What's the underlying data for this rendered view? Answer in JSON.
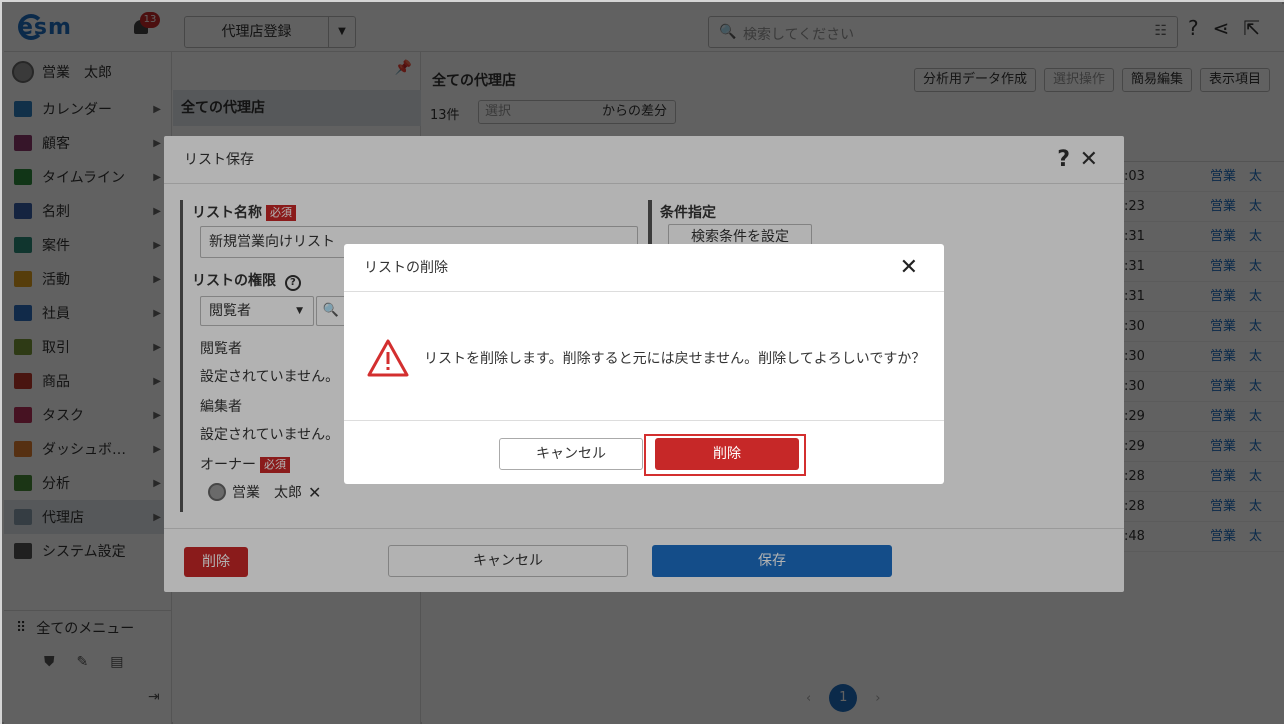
{
  "app": {
    "logo_text": "esm",
    "notifications": "13",
    "register_button": "代理店登録",
    "search_placeholder": "検索してください"
  },
  "user": {
    "name": "営業　太郎"
  },
  "sidebar": {
    "items": [
      {
        "label": "カレンダー",
        "color": "#2e7fbf"
      },
      {
        "label": "顧客",
        "color": "#8e3a6e"
      },
      {
        "label": "タイムライン",
        "color": "#2e8b3e"
      },
      {
        "label": "名刺",
        "color": "#3a5fa8"
      },
      {
        "label": "案件",
        "color": "#2a8a7a"
      },
      {
        "label": "活動",
        "color": "#e0a020"
      },
      {
        "label": "社員",
        "color": "#2e6fbf"
      },
      {
        "label": "取引",
        "color": "#7a9a3a"
      },
      {
        "label": "商品",
        "color": "#c0392b"
      },
      {
        "label": "タスク",
        "color": "#b8325a"
      },
      {
        "label": "ダッシュボ…",
        "color": "#e08030"
      },
      {
        "label": "分析",
        "color": "#4a8a3a"
      },
      {
        "label": "代理店",
        "color": "#8aa0b0"
      },
      {
        "label": "システム設定",
        "color": "#555555"
      }
    ],
    "all_menu": "全てのメニュー"
  },
  "list_panel": {
    "selected": "全ての代理店"
  },
  "main": {
    "title": "全ての代理店",
    "count": "13件",
    "diff_placeholder": "選択",
    "diff_suffix": "からの差分",
    "toolbar": [
      "分析用データ作成",
      "選択操作",
      "簡易編集",
      "表示項目"
    ],
    "rows": [
      {
        "time": ":03",
        "user": "営業　太"
      },
      {
        "time": ":23",
        "user": "営業　太"
      },
      {
        "time": ":31",
        "user": "営業　太"
      },
      {
        "time": ":31",
        "user": "営業　太"
      },
      {
        "time": ":31",
        "user": "営業　太"
      },
      {
        "time": ":30",
        "user": "営業　太"
      },
      {
        "time": ":30",
        "user": "営業　太"
      },
      {
        "time": ":30",
        "user": "営業　太"
      },
      {
        "time": ":29",
        "user": "営業　太"
      },
      {
        "time": ":29",
        "user": "営業　太"
      },
      {
        "time": ":28",
        "user": "営業　太"
      },
      {
        "time": ":28",
        "user": "営業　太"
      },
      {
        "time": ":48",
        "user": "営業　太"
      }
    ],
    "page": "1"
  },
  "save_dialog": {
    "title": "リスト保存",
    "list_name_label": "リスト名称",
    "required": "必須",
    "list_name_value": "新規営業向けリスト",
    "permission_label": "リストの権限",
    "role_value": "閲覧者",
    "viewer_label": "閲覧者",
    "viewer_value": "設定されていません。",
    "editor_label": "編集者",
    "editor_value": "設定されていません。",
    "owner_label": "オーナー",
    "owner_value": "営業　太郎",
    "condition_label": "条件指定",
    "condition_button": "検索条件を設定",
    "delete_button": "削除",
    "cancel_button": "キャンセル",
    "save_button": "保存"
  },
  "delete_dialog": {
    "title": "リストの削除",
    "message": "リストを削除します。削除すると元には戻せません。削除してよろしいですか？",
    "cancel_button": "キャンセル",
    "delete_button": "削除",
    "highlight_color": "#d32f2f"
  }
}
